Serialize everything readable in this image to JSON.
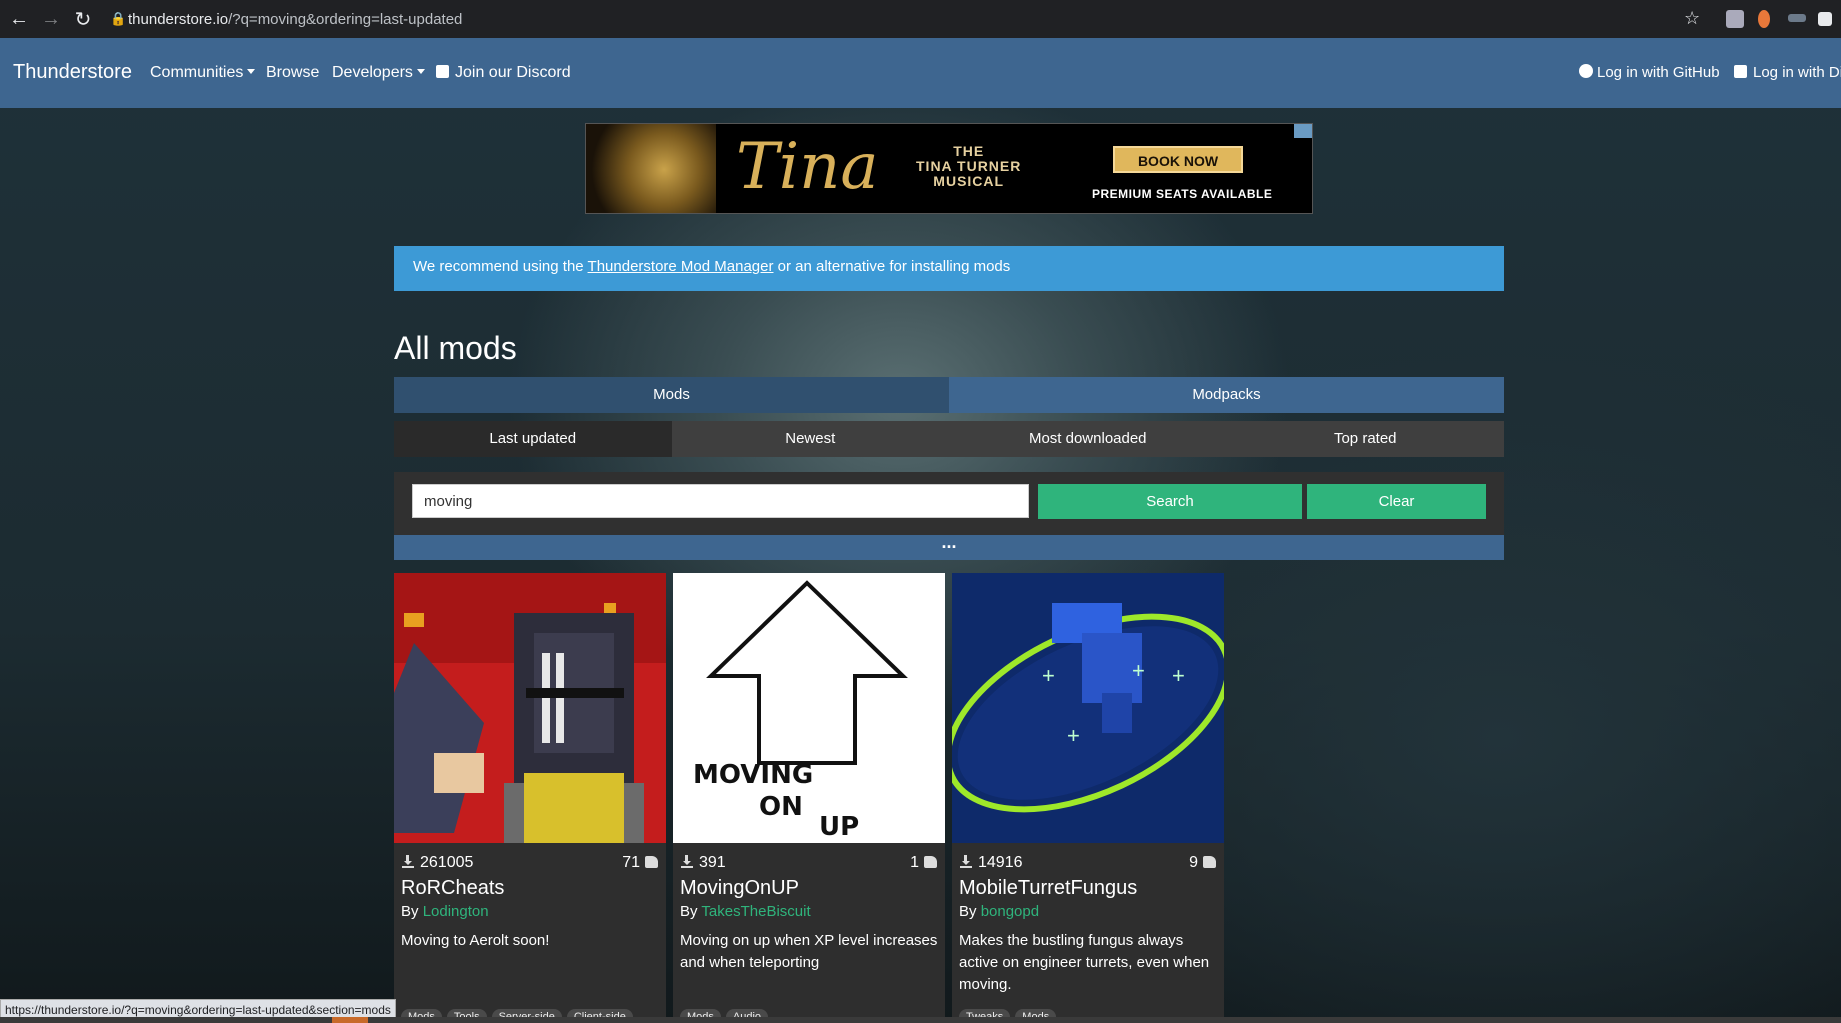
{
  "browser": {
    "url_host": "thunderstore.io",
    "url_path": "/?q=moving&ordering=last-updated",
    "status_url": "https://thunderstore.io/?q=moving&ordering=last-updated&section=mods"
  },
  "nav": {
    "brand": "Thunderstore",
    "communities": "Communities",
    "browse": "Browse",
    "developers": "Developers",
    "discord": "Join our Discord",
    "login_github": "Log in with GitHub",
    "login_discord": "Log in with Di"
  },
  "ad": {
    "title": "Tina",
    "subtitle_line1": "THE",
    "subtitle_line2": "TINA TURNER",
    "subtitle_line3": "MUSICAL",
    "cta": "BOOK NOW",
    "tagline": "PREMIUM SEATS AVAILABLE"
  },
  "alert": {
    "prefix": "We recommend using the ",
    "link": "Thunderstore Mod Manager",
    "suffix": " or an alternative for installing mods"
  },
  "page_title": "All mods",
  "section_tabs": {
    "mods": "Mods",
    "modpacks": "Modpacks"
  },
  "sort_tabs": {
    "last_updated": "Last updated",
    "newest": "Newest",
    "most_downloaded": "Most downloaded",
    "top_rated": "Top rated"
  },
  "search": {
    "value": "moving",
    "search_label": "Search",
    "clear_label": "Clear"
  },
  "more_label": "...",
  "cards": [
    {
      "downloads": "261005",
      "rating": "71",
      "name": "RoRCheats",
      "by": "By ",
      "author": "Lodington",
      "description": "Moving to Aerolt soon!",
      "tags": [
        "Mods",
        "Tools",
        "Server-side",
        "Client-side"
      ]
    },
    {
      "downloads": "391",
      "rating": "1",
      "name": "MovingOnUP",
      "by": "By ",
      "author": "TakesTheBiscuit",
      "description": "Moving on up when XP level increases and when teleporting",
      "tags": [
        "Mods",
        "Audio"
      ],
      "thumb_text": [
        "MOVING",
        "ON",
        "UP"
      ]
    },
    {
      "downloads": "14916",
      "rating": "9",
      "name": "MobileTurretFungus",
      "by": "By ",
      "author": "bongopd",
      "description": "Makes the bustling fungus always active on engineer turrets, even when moving.",
      "tags": [
        "Tweaks",
        "Mods"
      ]
    }
  ],
  "colors": {
    "nav_bg": "#3e6690",
    "alert_bg": "#3d9ad6",
    "accent_green": "#2fb47c",
    "card_bg": "#2e2e2e"
  }
}
